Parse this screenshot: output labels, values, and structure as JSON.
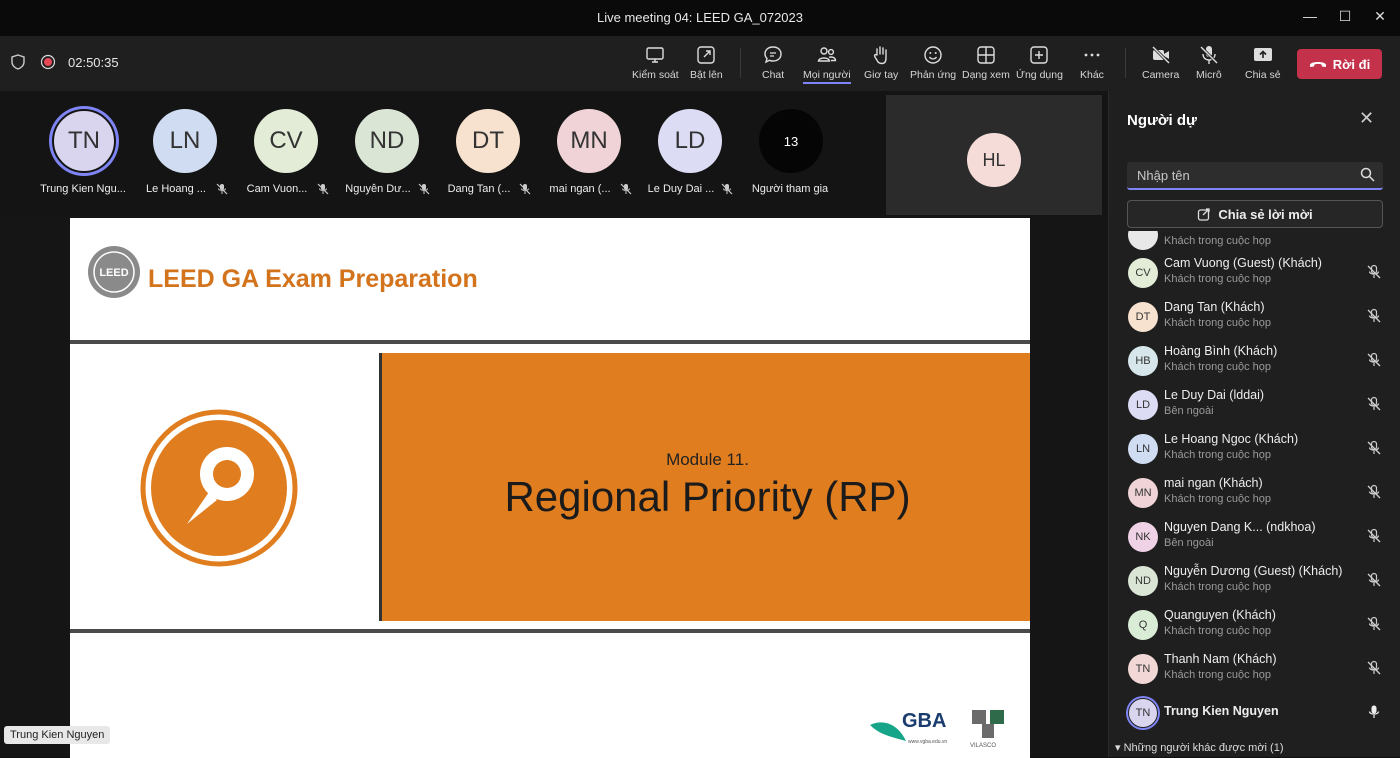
{
  "window": {
    "title": "Live meeting 04: LEED GA_072023"
  },
  "toolbar": {
    "timer": "02:50:35",
    "buttons": {
      "control": "Kiểm soát",
      "popout": "Bật lên",
      "chat": "Chat",
      "people": "Mọi người",
      "raise_hand": "Giơ tay",
      "react": "Phản ứng",
      "view": "Dạng xem",
      "apps": "Ứng dụng",
      "more": "Khác",
      "camera": "Camera",
      "mic": "Micrô",
      "share": "Chia sẻ"
    },
    "leave": "Rời đi"
  },
  "strip": {
    "tiles": [
      {
        "initials": "TN",
        "name": "Trung Kien Ngu...",
        "color": "#d9d5ee"
      },
      {
        "initials": "LN",
        "name": "Le Hoang ...",
        "color": "#cfdcf1"
      },
      {
        "initials": "CV",
        "name": "Cam Vuon...",
        "color": "#e2ecd7"
      },
      {
        "initials": "ND",
        "name": "Nguyễn Dư...",
        "color": "#dbe5d6"
      },
      {
        "initials": "DT",
        "name": "Dang Tan (...",
        "color": "#f7e1cf"
      },
      {
        "initials": "MN",
        "name": "mai ngan (...",
        "color": "#efd3d6"
      },
      {
        "initials": "LD",
        "name": "Le Duy Dai ...",
        "color": "#dcdcf4"
      }
    ],
    "overflow_count": "13",
    "overflow_label": "Người tham gia",
    "spotlight_initials": "HL"
  },
  "slide": {
    "header": "LEED GA Exam Preparation",
    "logo_text": "LEED",
    "module": "Module 11.",
    "title": "Regional Priority (RP)",
    "gba": "GBA",
    "gba_sub": "www.vgba.edu.vn",
    "vilas": "VILASCO"
  },
  "presenter_tag": "Trung Kien Nguyen",
  "panel": {
    "title": "Người dự",
    "search_placeholder": "Nhập tên",
    "share_invite": "Chia sẻ lời mời",
    "partial_sub": "Khách trong cuộc họp",
    "participants": [
      {
        "initials": "CV",
        "name": "Cam Vuong (Guest) (Khách)",
        "sub": "Khách trong cuộc họp",
        "color": "#e2ecd7",
        "muted": true
      },
      {
        "initials": "DT",
        "name": "Dang Tan (Khách)",
        "sub": "Khách trong cuộc họp",
        "color": "#f7e1cf",
        "muted": true
      },
      {
        "initials": "HB",
        "name": "Hoàng Bình (Khách)",
        "sub": "Khách trong cuộc họp",
        "color": "#d6e6ea",
        "muted": true
      },
      {
        "initials": "LD",
        "name": "Le Duy Dai (lddai)",
        "sub": "Bên ngoài",
        "color": "#dcdcf4",
        "muted": true
      },
      {
        "initials": "LN",
        "name": "Le Hoang Ngoc (Khách)",
        "sub": "Khách trong cuộc họp",
        "color": "#cfdcf1",
        "muted": true
      },
      {
        "initials": "MN",
        "name": "mai ngan (Khách)",
        "sub": "Khách trong cuộc họp",
        "color": "#efd3d6",
        "muted": true
      },
      {
        "initials": "NK",
        "name": "Nguyen Dang K...  (ndkhoa)",
        "sub": "Bên ngoài",
        "color": "#efd2e6",
        "muted": true
      },
      {
        "initials": "ND",
        "name": "Nguyễn Dương (Guest) (Khách)",
        "sub": "Khách trong cuộc họp",
        "color": "#dbe5d6",
        "muted": true
      },
      {
        "initials": "Q",
        "name": "Quanguyen (Khách)",
        "sub": "Khách trong cuộc họp",
        "color": "#d9ecd6",
        "muted": true
      },
      {
        "initials": "TN",
        "name": "Thanh Nam (Khách)",
        "sub": "Khách trong cuộc họp",
        "color": "#f2d7d7",
        "muted": true
      },
      {
        "initials": "TN",
        "name": "Trung Kien Nguyen",
        "sub": "",
        "color": "#d9d5ee",
        "muted": false
      }
    ],
    "more_invited": "Những người khác được mời (1)"
  }
}
